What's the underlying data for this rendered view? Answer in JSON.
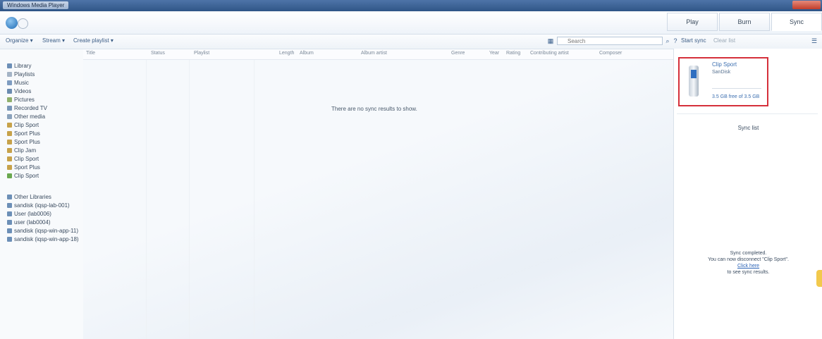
{
  "window": {
    "title": "Windows Media Player"
  },
  "tabs": [
    {
      "label": "Play"
    },
    {
      "label": "Burn"
    },
    {
      "label": "Sync"
    }
  ],
  "toolbar": {
    "organize": "Organize ▾",
    "stream": "Stream ▾",
    "create_playlist": "Create playlist ▾",
    "search_placeholder": "Search",
    "start_sync": "Start sync",
    "clear_list": "Clear list"
  },
  "sidebar": {
    "library": [
      "Library",
      "Playlists",
      "Music",
      "Videos",
      "Pictures",
      "Recorded TV",
      "Other media",
      "Clip Sport",
      "Sport Plus",
      "Sport Plus",
      "Clip Jam",
      "Clip Sport",
      "Sport Plus",
      "Clip Sport"
    ],
    "other": [
      "Other Libraries",
      "sandisk (iqsp-lab-001)",
      "User (lab0006)",
      "user (lab0004)",
      "sandisk (iqsp-win-app-11)",
      "sandisk (iqsp-win-app-18)"
    ]
  },
  "columns": [
    "Title",
    "Status",
    "Playlist",
    "Length",
    "Album",
    "Album artist",
    "Genre",
    "Year",
    "Rating",
    "Contributing artist",
    "Composer"
  ],
  "empty_text": "There are no sync results to show.",
  "device": {
    "name": "Clip Sport",
    "sub": "SanDisk",
    "capacity": "3.5 GB free of 3.5 GB"
  },
  "sync_list_title": "Sync list",
  "sync_message": {
    "line1": "Sync completed.",
    "line2": "You can now disconnect \"Clip Sport\".",
    "link": "Click here",
    "line3": "to see sync results."
  }
}
